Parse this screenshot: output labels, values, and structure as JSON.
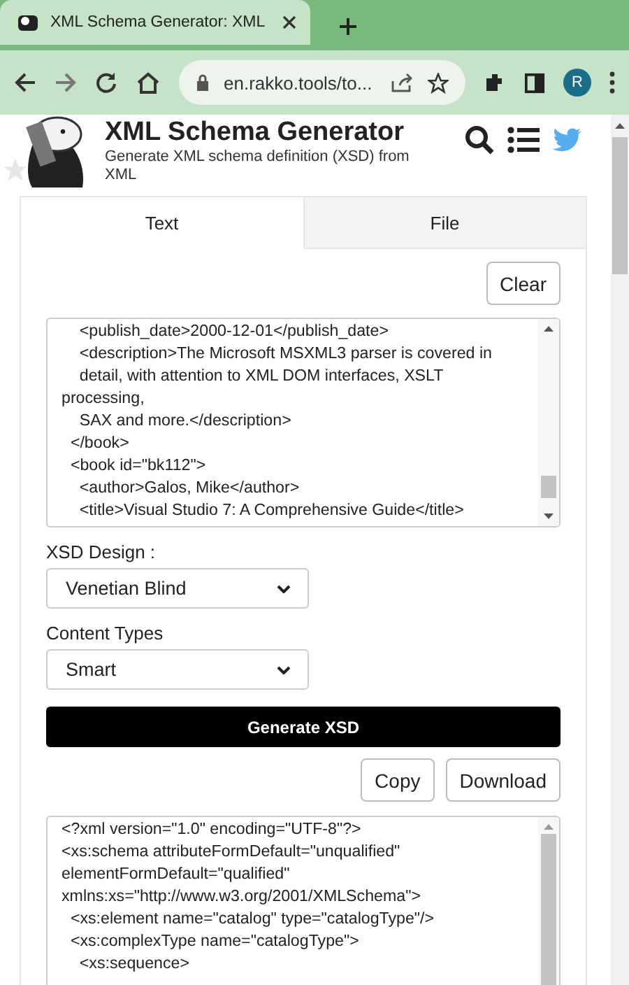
{
  "browser": {
    "tab_title": "XML Schema Generator: XML",
    "url": "en.rakko.tools/to...",
    "avatar": "R"
  },
  "header": {
    "title": "XML Schema Generator",
    "subtitle": "Generate XML schema definition (XSD) from XML"
  },
  "tabs": [
    {
      "label": "Text",
      "selected": true
    },
    {
      "label": "File",
      "selected": false
    }
  ],
  "clear_button": "Clear",
  "input_lines": [
    "    <publish_date>2000-12-01</publish_date>",
    "    <description>The Microsoft MSXML3 parser is covered in",
    "    detail, with attention to XML DOM interfaces, XSLT",
    "processing,",
    "    SAX and more.</description>",
    "  </book>",
    "  <book id=\"bk112\">",
    "    <author>Galos, Mike</author>",
    "    <title>Visual Studio 7: A Comprehensive Guide</title>"
  ],
  "xsd_design": {
    "label": "XSD Design :",
    "value": "Venetian Blind"
  },
  "content_types": {
    "label": "Content Types",
    "value": "Smart"
  },
  "generate_button": "Generate XSD",
  "copy_button": "Copy",
  "download_button": "Download",
  "output_lines": [
    "<?xml version=\"1.0\" encoding=\"UTF-8\"?>",
    "<xs:schema attributeFormDefault=\"unqualified\"",
    "elementFormDefault=\"qualified\"",
    "xmlns:xs=\"http://www.w3.org/2001/XMLSchema\">",
    "  <xs:element name=\"catalog\" type=\"catalogType\"/>",
    "  <xs:complexType name=\"catalogType\">",
    "    <xs:sequence>"
  ]
}
